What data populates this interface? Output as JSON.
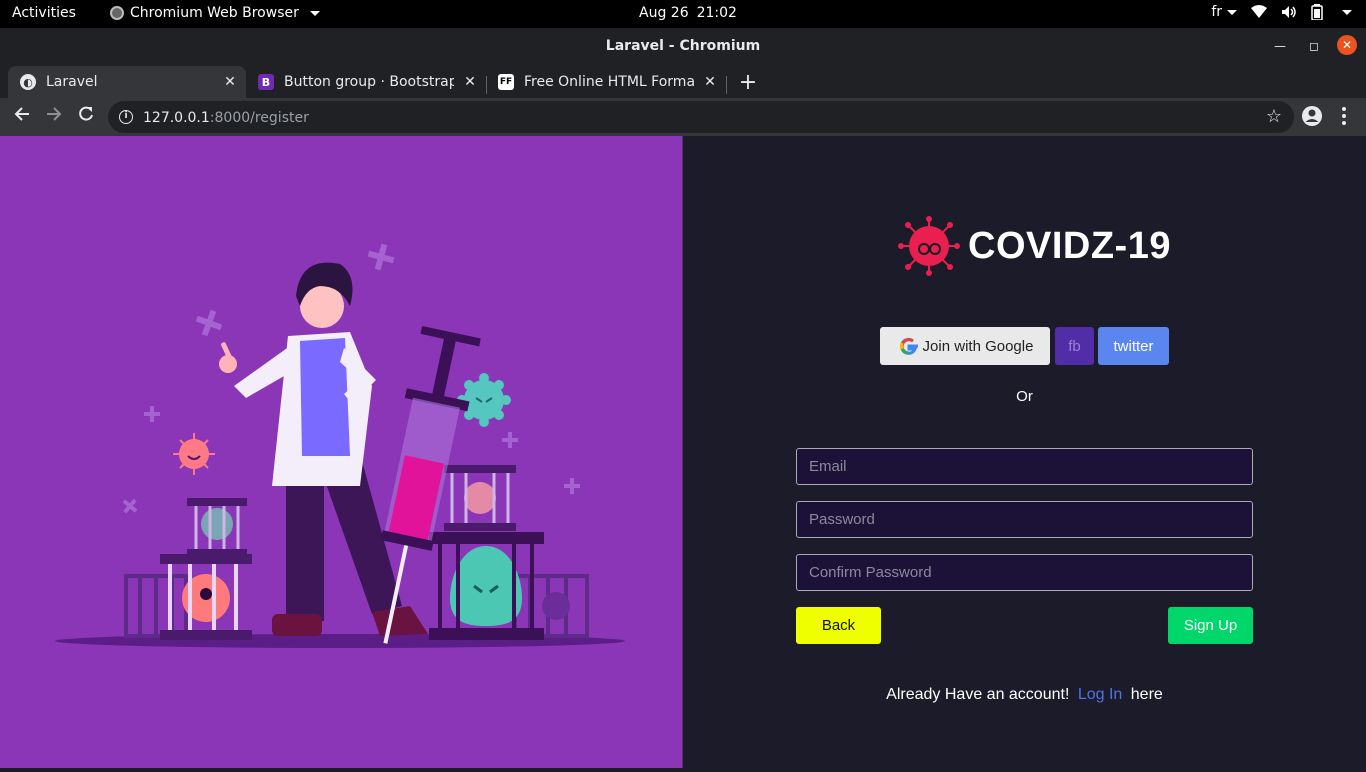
{
  "system_bar": {
    "activities": "Activities",
    "app_name": "Chromium Web Browser",
    "date": "Aug 26",
    "time": "21:02",
    "keyboard_layout": "fr"
  },
  "window": {
    "title": "Laravel - Chromium"
  },
  "tabs": [
    {
      "label": "Laravel",
      "icon": "globe-icon"
    },
    {
      "label": "Button group · Bootstrap",
      "icon": "bootstrap-icon"
    },
    {
      "label": "Free Online HTML Format",
      "icon": "ff-icon"
    }
  ],
  "tab_fav_text": {
    "bootstrap": "B",
    "ff": "FF"
  },
  "address_bar": {
    "host": "127.0.0.1",
    "rest": ":8000/register"
  },
  "page": {
    "brand": "COVIDZ-19",
    "social": {
      "google": "Join with Google",
      "fb": "fb",
      "twitter": "twitter"
    },
    "or_text": "Or",
    "email_placeholder": "Email",
    "password_placeholder": "Password",
    "confirm_placeholder": "Confirm Password",
    "back": "Back",
    "signup": "Sign Up",
    "account_prefix": "Already Have an account!",
    "login_link": "Log In",
    "account_suffix": "here"
  },
  "colors": {
    "left_bg": "#8a36b6",
    "right_bg": "#1b1b2a",
    "back_btn": "#f0ff00",
    "signup_btn": "#00d66a",
    "twitter_btn": "#5b86f0",
    "fb_btn": "#512da8",
    "link": "#4e72e8"
  }
}
